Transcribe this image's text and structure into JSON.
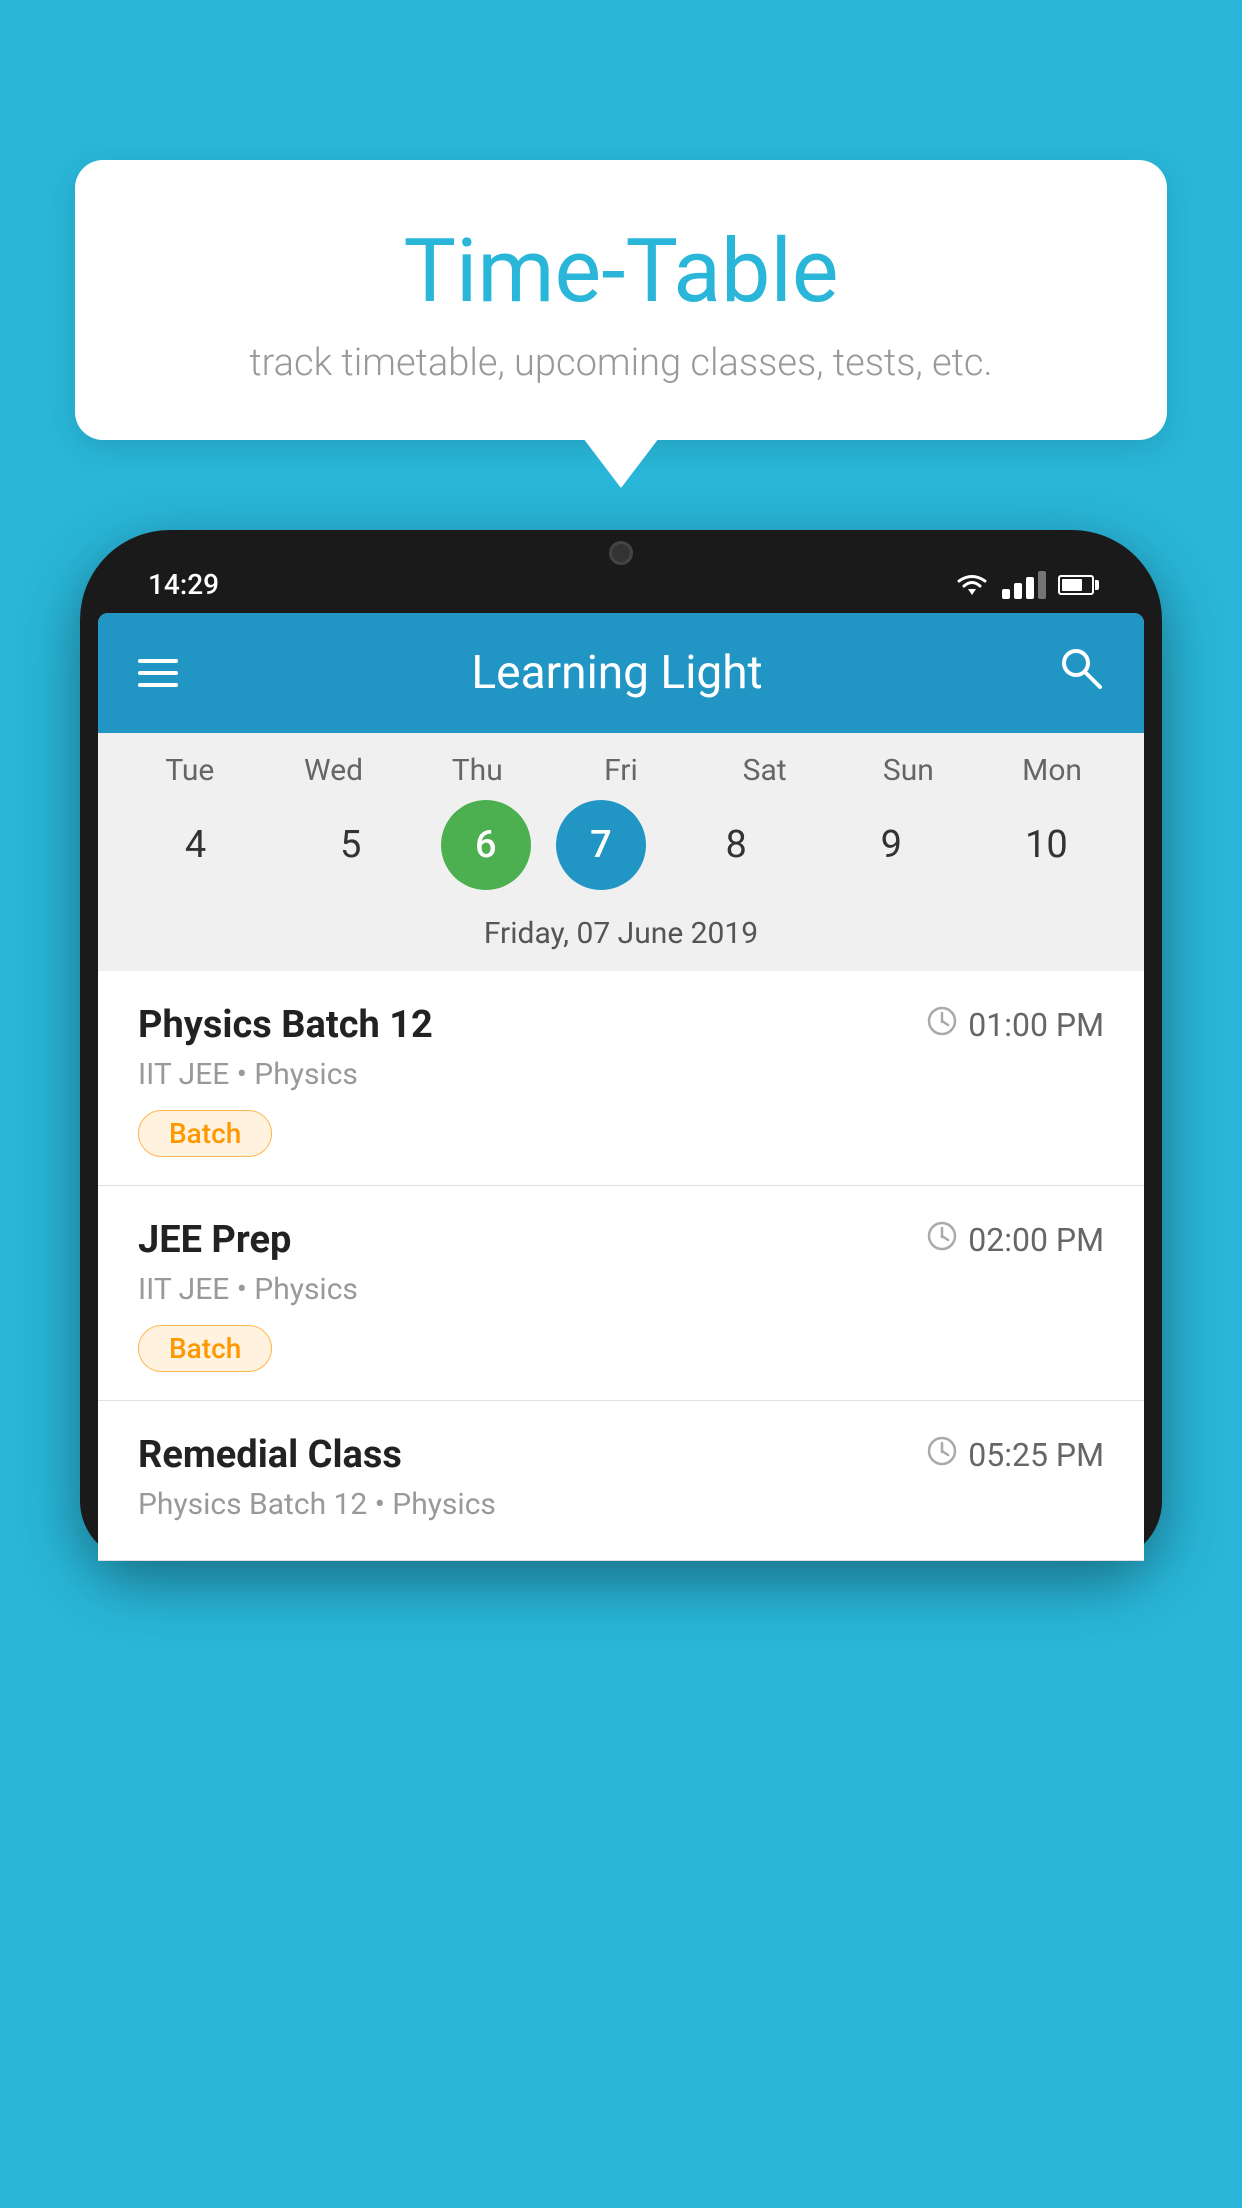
{
  "background_color": "#29B6D8",
  "speech_bubble": {
    "title": "Time-Table",
    "subtitle": "track timetable, upcoming classes, tests, etc."
  },
  "phone": {
    "status_bar": {
      "time": "14:29"
    },
    "app_bar": {
      "title": "Learning Light"
    },
    "calendar": {
      "days": [
        {
          "label": "Tue",
          "number": "4"
        },
        {
          "label": "Wed",
          "number": "5"
        },
        {
          "label": "Thu",
          "number": "6",
          "state": "today"
        },
        {
          "label": "Fri",
          "number": "7",
          "state": "selected"
        },
        {
          "label": "Sat",
          "number": "8"
        },
        {
          "label": "Sun",
          "number": "9"
        },
        {
          "label": "Mon",
          "number": "10"
        }
      ],
      "selected_date_label": "Friday, 07 June 2019"
    },
    "schedule": [
      {
        "title": "Physics Batch 12",
        "time": "01:00 PM",
        "subtitle": "IIT JEE • Physics",
        "tag": "Batch"
      },
      {
        "title": "JEE Prep",
        "time": "02:00 PM",
        "subtitle": "IIT JEE • Physics",
        "tag": "Batch"
      },
      {
        "title": "Remedial Class",
        "time": "05:25 PM",
        "subtitle": "Physics Batch 12 • Physics",
        "tag": null
      }
    ]
  }
}
